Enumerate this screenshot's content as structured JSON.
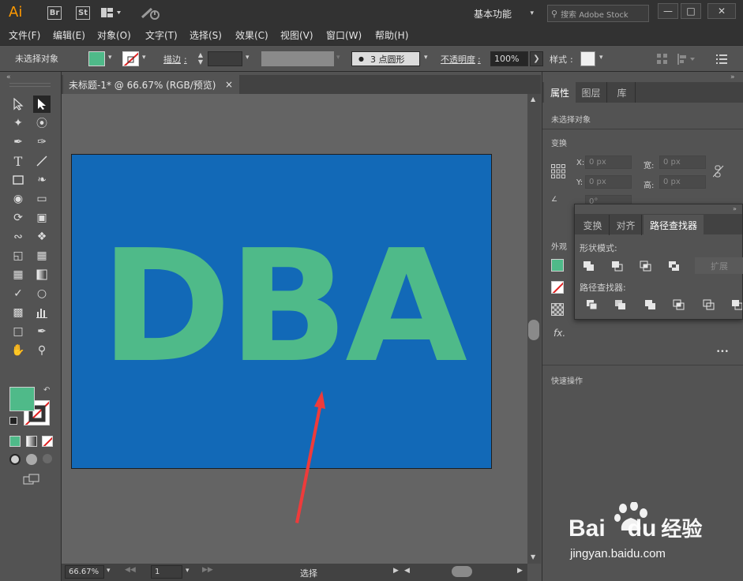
{
  "app": {
    "logo": "Ai",
    "bridge": "Br",
    "stock": "St",
    "workspace": "基本功能",
    "search_placeholder": "搜索 Adobe Stock"
  },
  "menus": [
    "文件(F)",
    "编辑(E)",
    "对象(O)",
    "文字(T)",
    "选择(S)",
    "效果(C)",
    "视图(V)",
    "窗口(W)",
    "帮助(H)"
  ],
  "control": {
    "selection": "未选择对象",
    "stroke_label": "描边",
    "stroke_colon": ":",
    "brush": "3 点圆形",
    "opacity_label": "不透明度",
    "opacity_colon": ":",
    "opacity_value": "100%",
    "style_label": "样式",
    "style_colon": ":"
  },
  "document": {
    "tab_title": "未标题-1* @ 66.67% (RGB/预览)",
    "close": "×",
    "artboard_text": "DBA",
    "zoom": "66.67%",
    "page": "1",
    "status": "选择"
  },
  "properties": {
    "tabs": [
      "属性",
      "图层",
      "库"
    ],
    "selection": "未选择对象",
    "transform": "变换",
    "x_label": "X:",
    "y_label": "Y:",
    "w_label": "宽:",
    "h_label": "高:",
    "x": "0 px",
    "y": "0 px",
    "w": "0 px",
    "h": "0 px",
    "rotate": "0°",
    "appearance": "外观",
    "fx": "fx.",
    "more": "•••",
    "quick_actions": "快速操作"
  },
  "pathfinder": {
    "tabs": [
      "变换",
      "对齐",
      "路径查找器"
    ],
    "shape_modes": "形状模式:",
    "expand": "扩展",
    "pathfinders": "路径查找器:"
  },
  "colors": {
    "fill": "#4fba89",
    "artboard": "#1269b7",
    "arrow": "#ee3b3b",
    "ai_logo": "#ff9a00"
  },
  "watermark": {
    "line1_a": "Bai",
    "line1_b": "du",
    "line1_c": "经验",
    "line2": "jingyan.baidu.com"
  }
}
